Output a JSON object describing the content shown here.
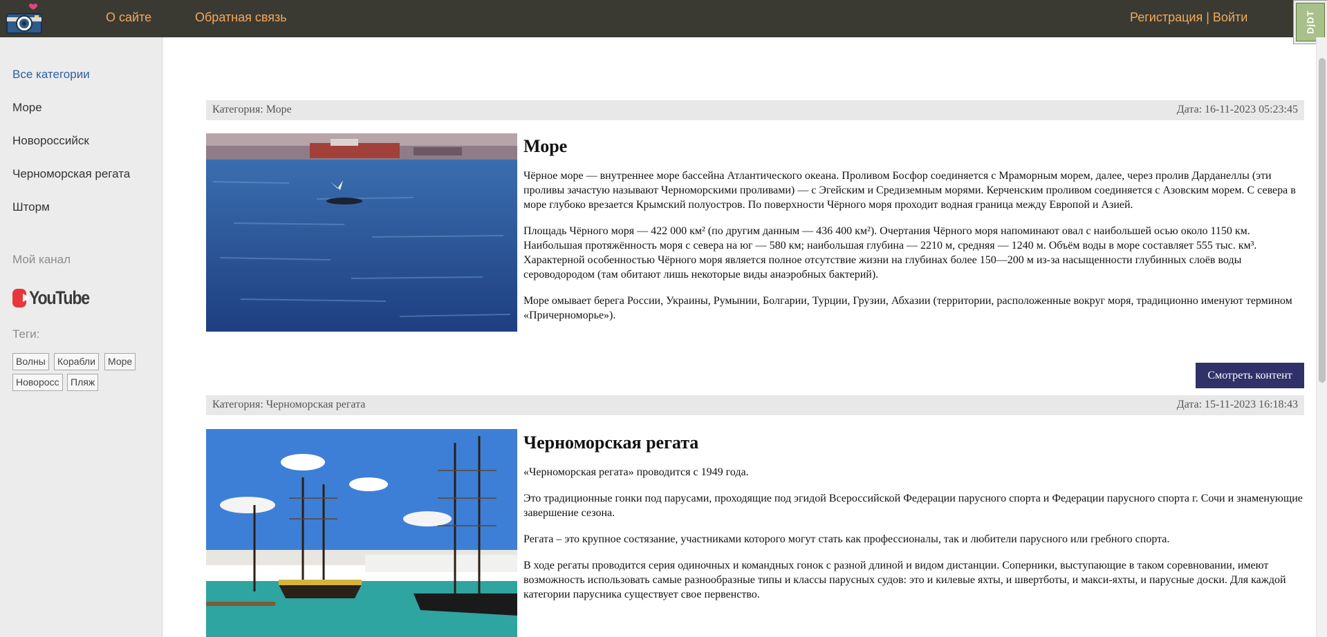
{
  "header": {
    "nav": {
      "about": "О сайте",
      "feedback": "Обратная связь"
    },
    "auth": {
      "register": "Регистрация",
      "separator": " | ",
      "login": "Войти"
    },
    "toolbar_handle": "DjDT"
  },
  "sidebar": {
    "categories": [
      {
        "label": "Все категории",
        "active": true
      },
      {
        "label": "Море"
      },
      {
        "label": "Новороссийск"
      },
      {
        "label": "Черноморская регата"
      },
      {
        "label": "Шторм"
      }
    ],
    "channel_heading": "Мой канал",
    "youtube_label": "YouTube",
    "tags_heading": "Теги:",
    "tags": [
      "Волны",
      "Корабли",
      "Море",
      "Новоросс",
      "Пляж"
    ]
  },
  "posts": [
    {
      "category": "Категория: Море",
      "date": "Дата: 16-11-2023 05:23:45",
      "title": "Море",
      "paragraphs": [
        "Чёрное море — внутреннее море бассейна Атлантического океана. Проливом Босфор соединяется с Мраморным морем, далее, через пролив Дарданеллы (эти проливы зачастую называют Черноморскими проливами) — с Эгейским и Средиземным морями. Керченским проливом соединяется с Азовским морем. С севера в море глубоко врезается Крымский полуостров. По поверхности Чёрного моря проходит водная граница между Европой и Азией.",
        "Площадь Чёрного моря — 422 000 км² (по другим данным — 436 400 км²). Очертания Чёрного моря напоминают овал с наибольшей осью около 1150 км. Наибольшая протяжённость моря с севера на юг — 580 км; наибольшая глубина — 2210 м, средняя — 1240 м. Объём воды в море составляет 555 тыс. км³. Характерной особенностью Чёрного моря является полное отсутствие жизни на глубинах более 150—200 м из-за насыщенности глубинных слоёв воды сероводородом (там обитают лишь некоторые виды анаэробных бактерий).",
        "Море омывает берега России, Украины, Румынии, Болгарии, Турции, Грузии, Абхазии (территории, расположенные вокруг моря, традиционно именуют термином «Причерноморье»)."
      ],
      "button": "Смотреть контент"
    },
    {
      "category": "Категория: Черноморская регата",
      "date": "Дата: 15-11-2023 16:18:43",
      "title": "Черноморская регата",
      "paragraphs": [
        "«Черноморская регата» проводится с 1949 года.",
        "Это традиционные гонки под парусами, проходящие под эгидой Всероссийской Федерации парусного спорта и Федерации парусного спорта г. Сочи и знаменующие завершение сезона.",
        "Регата – это крупное состязание, участниками которого могут стать как профессионалы, так и любители парусного или гребного спорта.",
        "В ходе регаты проводится серия одиночных и командных гонок с разной длиной и видом дистанции. Соперники, выступающие в таком соревновании, имеют возможность использовать самые разнообразные типы и классы парусных судов: это и килевые яхты, и швертботы, и макси-яхты, и парусные доски. Для каждой категории парусника существует свое первенство."
      ]
    }
  ],
  "colors": {
    "topbar": "#3a3a33",
    "nav_link": "#f3a95c",
    "active_category": "#2a5f9e",
    "button": "#2f3168",
    "youtube_red": "#e8373a"
  },
  "icons": {
    "logo": "camera-heart-icon",
    "youtube": "youtube-play-icon"
  }
}
